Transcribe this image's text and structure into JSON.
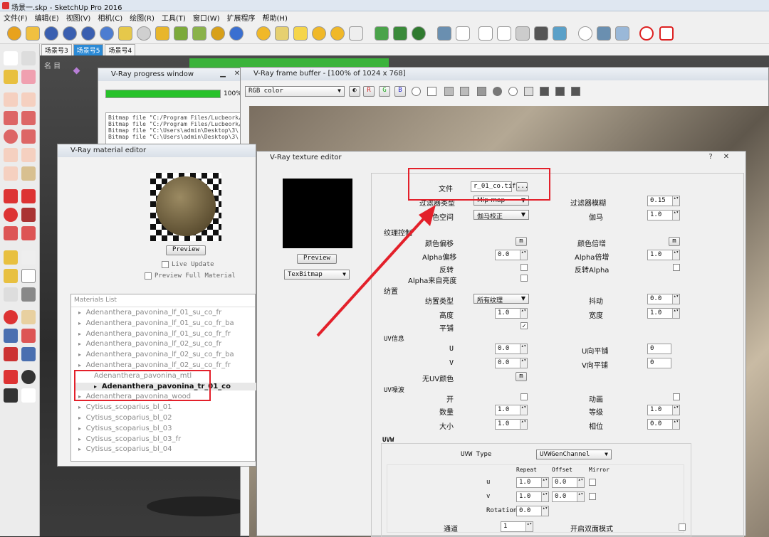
{
  "window": {
    "title": "场景一.skp - SketchUp Pro 2016"
  },
  "menu": [
    "文件(F)",
    "编辑(E)",
    "视图(V)",
    "相机(C)",
    "绘图(R)",
    "工具(T)",
    "窗口(W)",
    "扩展程序",
    "帮助(H)"
  ],
  "scene_tabs": [
    {
      "label": "场景号3",
      "active": false
    },
    {
      "label": "场景号5",
      "active": true
    },
    {
      "label": "场景号4",
      "active": false
    }
  ],
  "viewport_label": "名 目",
  "progress": {
    "title": "V-Ray progress window",
    "percent_text": "100%",
    "percent": 1.0,
    "log": [
      "Bitmap file \"C:/Program Files/Lucbeork/",
      "Bitmap file \"C:/Program Files/Lucbeork/",
      "Bitmap file \"C:\\Users\\admin\\Desktop\\3\\",
      "Bitmap file \"C:\\Users\\admin\\Desktop\\3\\"
    ]
  },
  "framebuffer": {
    "title": "V-Ray frame buffer - [100% of 1024 x 768]",
    "channel": "RGB color",
    "r": "R",
    "g": "G",
    "b": "B"
  },
  "material_editor": {
    "title": "V-Ray material editor",
    "preview_btn": "Preview",
    "live_update": "Live Update",
    "preview_full": "Preview Full Material",
    "list_header": "Materials List",
    "items": [
      "Adenanthera_pavonina_lf_01_su_co_fr",
      "Adenanthera_pavonina_lf_01_su_co_fr_ba",
      "Adenanthera_pavonina_lf_01_su_co_fr_fr",
      "Adenanthera_pavonina_lf_02_su_co_fr",
      "Adenanthera_pavonina_lf_02_su_co_fr_ba",
      "Adenanthera_pavonina_lf_02_su_co_fr_fr",
      "Adenanthera_pavonina_mtl",
      "Adenanthera_pavonina_tr_01_co",
      "Adenanthera_pavonina_wood",
      "Cytisus_scoparius_bl_01",
      "Cytisus_scoparius_bl_02",
      "Cytisus_scoparius_bl_03",
      "Cytisus_scoparius_bl_03_fr",
      "Cytisus_scoparius_bl_04"
    ],
    "selected_index": 7
  },
  "texture_editor": {
    "title": "V-Ray texture editor",
    "preview_btn": "Preview",
    "tex_type": "TexBitmap",
    "file_label": "文件",
    "file_value": "r_01_co.tif",
    "browse": "...",
    "filter_type_label": "过滤器类型",
    "filter_type_value": "Mip-map",
    "filter_blur_label": "过滤器模糊",
    "filter_blur_value": "0.15",
    "color_space_label": "颜色空间",
    "color_space_value": "伽马校正",
    "gamma_label": "伽马",
    "gamma_value": "1.0",
    "tex_ctrl": "纹理控制",
    "color_offset": "颜色偏移",
    "m": "m",
    "color_mult": "颜色倍增",
    "alpha_offset": "Alpha偏移",
    "alpha_offset_value": "0.0",
    "alpha_mult": "Alpha倍增",
    "alpha_mult_value": "1.0",
    "invert": "反转",
    "invert_alpha": "反转Alpha",
    "alpha_lum": "Alpha来自亮度",
    "tiling": "纺置",
    "tiling_type": "纺置类型",
    "tiling_type_value": "所有纹理",
    "jitter": "抖动",
    "jitter_value": "0.0",
    "height": "高度",
    "height_value": "1.0",
    "width": "宽度",
    "width_value": "1.0",
    "tile": "平铺",
    "uv_info": "UV信息",
    "u": "U",
    "u_value": "0.0",
    "u_tile": "U向平铺",
    "u_tile_value": "0",
    "v": "V",
    "v_value": "0.0",
    "v_tile": "V向平铺",
    "v_tile_value": "0",
    "no_uv": "无UV颜色",
    "uv_noise": "UV噪波",
    "on": "开",
    "anim": "动画",
    "count": "数量",
    "count_value": "1.0",
    "level": "等级",
    "level_value": "1.0",
    "size": "大小",
    "size_value": "1.0",
    "phase": "相位",
    "phase_value": "0.0",
    "uvw": "UVW",
    "uvw_type_label": "UVW Type",
    "uvw_type_value": "UVWGenChannel",
    "repeat": "Repeat",
    "offset": "Offset",
    "mirror": "Mirror",
    "u_axis": "u",
    "v_axis": "v",
    "u_repeat": "1.0",
    "u_offset": "0.0",
    "v_repeat": "1.0",
    "v_offset": "0.0",
    "rotation": "Rotation",
    "rotation_value": "0.0",
    "channel": "通道",
    "channel_value": "1",
    "double_sided": "开启双面模式"
  },
  "colors": {
    "accent_red": "#e3202a",
    "progress_green": "#27c22a",
    "selection_blue": "#2b8ad6"
  }
}
